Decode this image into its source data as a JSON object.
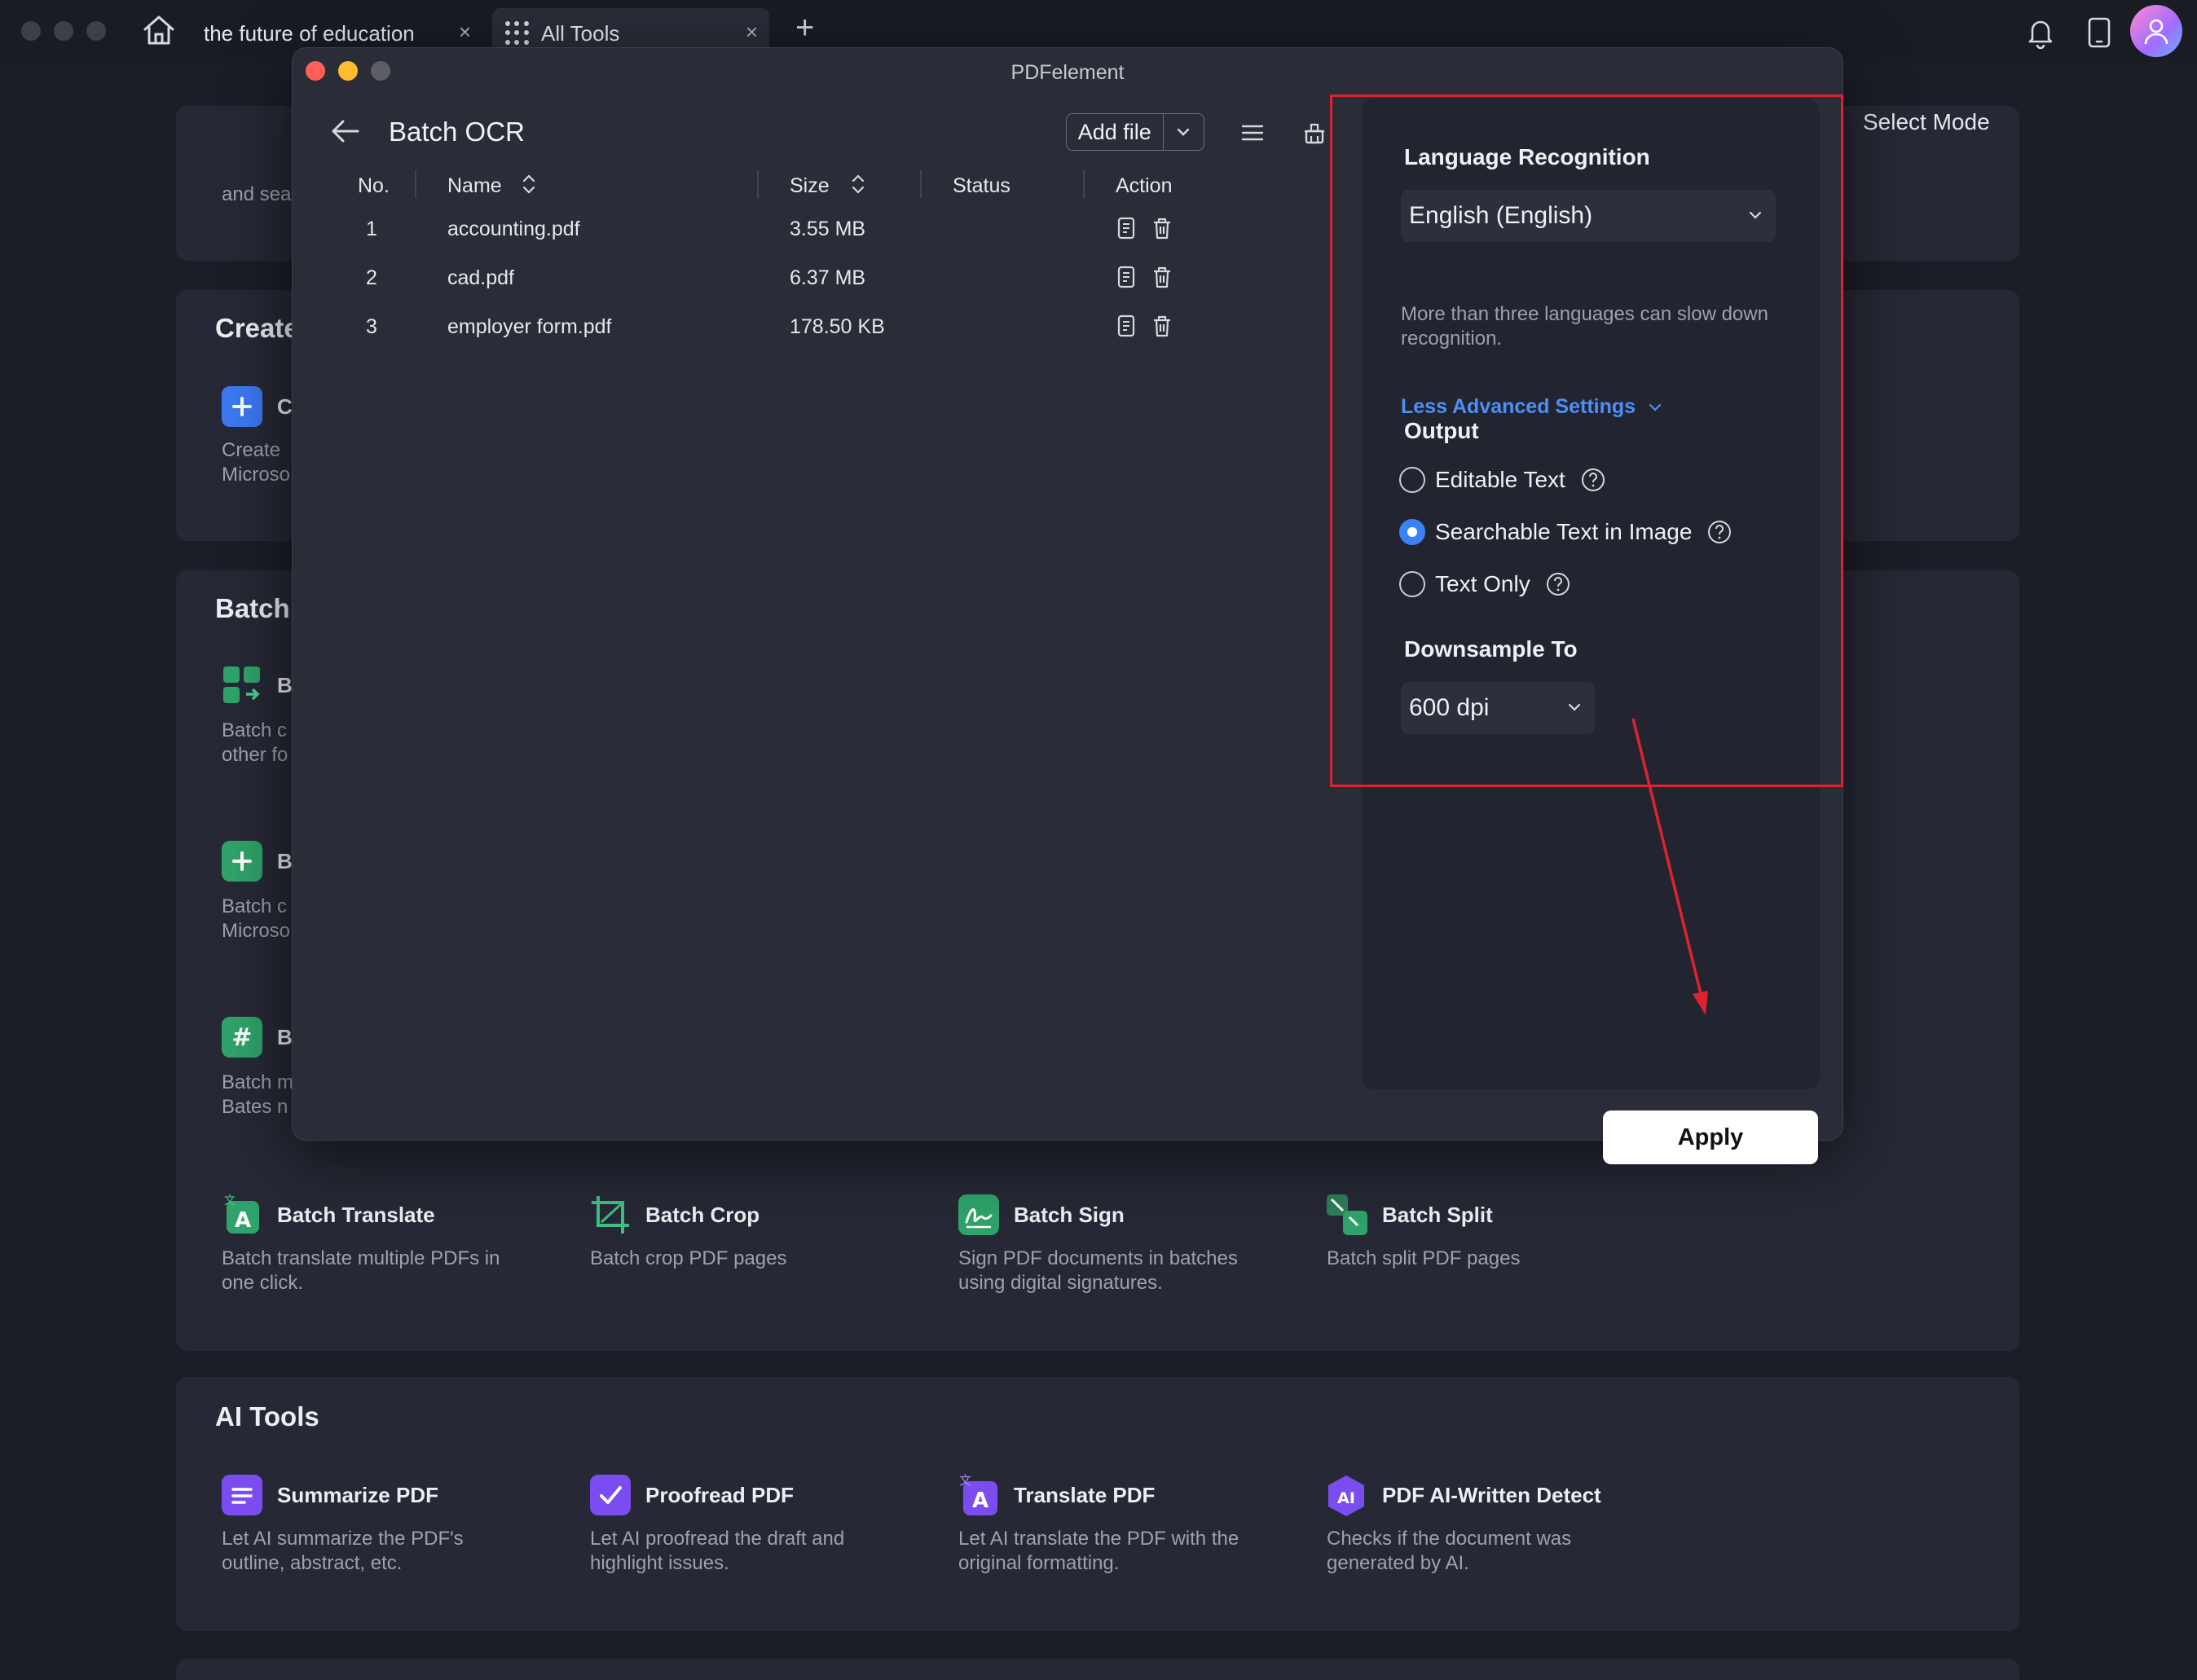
{
  "tabs": [
    {
      "title": "the future of education"
    },
    {
      "title": "All Tools"
    }
  ],
  "tab_close_glyph": "×",
  "tab_add_glyph": "+",
  "top_icons": [
    "home-icon",
    "bell-icon",
    "tablet-icon",
    "avatar"
  ],
  "background": {
    "select_mode": "Select Mode",
    "truncated": {
      "line1": "and sea",
      "create_heading": "Create",
      "create_tool": "C",
      "create_desc1": "Create",
      "create_desc2": "Microso",
      "batch_heading": "Batch",
      "b1_name": "B",
      "b1_d1": "Batch c",
      "b1_d2": "other fo",
      "b2_name": "B",
      "b2_d1": "Batch c",
      "b2_d2": "Microso",
      "b3_name": "B",
      "b3_d1": "Batch m",
      "b3_d2": "Bates n"
    },
    "batch_tools": [
      {
        "name": "Batch Translate",
        "desc1": "Batch translate multiple PDFs in",
        "desc2": "one click."
      },
      {
        "name": "Batch Crop",
        "desc1": "Batch crop PDF pages",
        "desc2": ""
      },
      {
        "name": "Batch Sign",
        "desc1": "Sign PDF documents in batches",
        "desc2": "using digital signatures."
      },
      {
        "name": "Batch Split",
        "desc1": "Batch split PDF pages",
        "desc2": ""
      }
    ],
    "ai_heading": "AI Tools",
    "ai_tools": [
      {
        "name": "Summarize PDF",
        "desc1": "Let AI summarize the PDF's",
        "desc2": "outline, abstract, etc."
      },
      {
        "name": "Proofread PDF",
        "desc1": "Let AI proofread the draft and",
        "desc2": "highlight issues."
      },
      {
        "name": "Translate PDF",
        "desc1": "Let AI translate the PDF with the",
        "desc2": "original formatting."
      },
      {
        "name": "PDF AI-Written Detect",
        "desc1": "Checks if the document was",
        "desc2": "generated by AI."
      }
    ]
  },
  "modal": {
    "window_title": "PDFelement",
    "panel_title": "Batch OCR",
    "add_file": "Add file",
    "columns": {
      "no": "No.",
      "name": "Name",
      "size": "Size",
      "status": "Status",
      "action": "Action"
    },
    "files": [
      {
        "no": "1",
        "name": "accounting.pdf",
        "size": "3.55 MB",
        "status": ""
      },
      {
        "no": "2",
        "name": "cad.pdf",
        "size": "6.37 MB",
        "status": ""
      },
      {
        "no": "3",
        "name": "employer form.pdf",
        "size": "178.50 KB",
        "status": ""
      }
    ],
    "settings": {
      "language_heading": "Language Recognition",
      "language_value": "English (English)",
      "language_note": "More than three languages can slow down recognition.",
      "advanced_link": "Less Advanced Settings",
      "output_heading": "Output",
      "output_options": [
        {
          "label": "Editable Text",
          "selected": false
        },
        {
          "label": "Searchable Text in Image",
          "selected": true
        },
        {
          "label": "Text Only",
          "selected": false
        }
      ],
      "downsample_heading": "Downsample To",
      "downsample_value": "600 dpi"
    },
    "apply": "Apply"
  },
  "colors": {
    "accent_blue": "#3b82f6",
    "link_blue": "#4d8ff7",
    "annotation_red": "#e02230",
    "close_red": "#ff5f57",
    "minimize_yellow": "#febc2e",
    "inactive_gray": "#5c5e66"
  }
}
